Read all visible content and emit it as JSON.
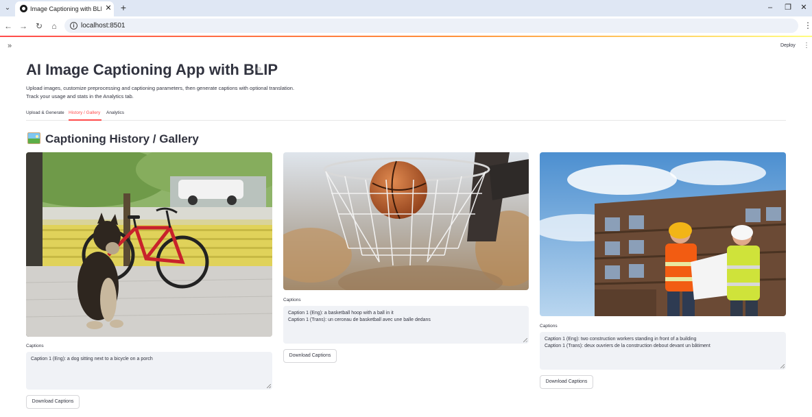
{
  "browser": {
    "tab_title": "Image Captioning with BLIP + AI",
    "url": "localhost:8501",
    "icons": [
      "tab-search-icon",
      "close-icon",
      "new-tab-icon",
      "minimize-icon",
      "restore-icon",
      "back-icon",
      "forward-icon",
      "reload-icon",
      "home-icon",
      "info-icon",
      "menu-icon"
    ]
  },
  "app": {
    "deploy_label": "Deploy",
    "title": "AI Image Captioning App with BLIP",
    "description": [
      "Upload images, customize preprocessing and captioning parameters, then generate captions with optional translation.",
      "Track your usage and stats in the Analytics tab."
    ],
    "tabs": [
      {
        "label": "Upload & Generate",
        "active": false
      },
      {
        "label": "History / Gallery",
        "active": true
      },
      {
        "label": "Analytics",
        "active": false
      }
    ],
    "section_heading": "Captioning History / Gallery",
    "accent_color": "#ff4b4b"
  },
  "gallery": [
    {
      "image_subject": "dog sitting next to a red bicycle on a yellow porch",
      "captions_label": "Captions",
      "captions": [
        "Caption 1 (Eng): a dog sitting next to a bicycle on a porch"
      ],
      "download_label": "Download Captions"
    },
    {
      "image_subject": "basketball going through a hoop net",
      "captions_label": "Captions",
      "captions": [
        "Caption 1 (Eng): a basketball hoop with a ball in it",
        "Caption 1 (Trans): un cerceau de basketball avec une balle dedans"
      ],
      "download_label": "Download Captions"
    },
    {
      "image_subject": "two construction workers in front of a building frame",
      "captions_label": "Captions",
      "captions": [
        "Caption 1 (Eng): two construction workers standing in front of a building",
        "Caption 1 (Trans): deux ouvriers de la construction debout devant un bâtiment"
      ],
      "download_label": "Download Captions"
    }
  ]
}
